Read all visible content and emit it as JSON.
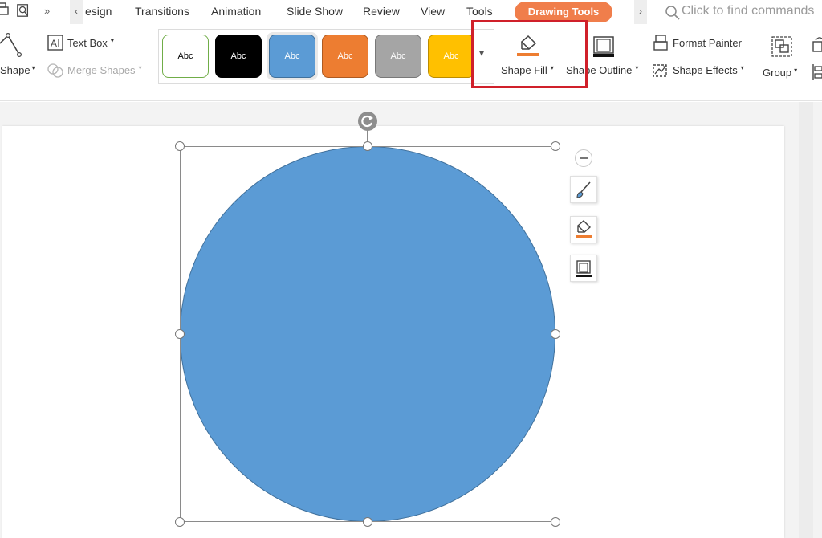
{
  "tabs": {
    "design": "esign",
    "transitions": "Transitions",
    "animation": "Animation",
    "slide_show": "Slide Show",
    "review": "Review",
    "view": "View",
    "tools": "Tools",
    "drawing_tools": "Drawing Tools"
  },
  "search": {
    "placeholder": "Click to find commands"
  },
  "ribbon": {
    "shape": "Shape",
    "text_box": "Text Box",
    "merge_shapes": "Merge Shapes",
    "shape_fill": "Shape Fill",
    "shape_outline": "Shape Outline",
    "format_painter": "Format Painter",
    "shape_effects": "Shape Effects",
    "group": "Group"
  },
  "style_gallery": [
    {
      "label": "Abc",
      "fill": "#ffffff",
      "border": "#70ad47",
      "text": "#000000"
    },
    {
      "label": "Abc",
      "fill": "#000000",
      "border": "#000000",
      "text": "#ffffff"
    },
    {
      "label": "Abc",
      "fill": "#5b9bd5",
      "border": "#41719c",
      "text": "#ffffff"
    },
    {
      "label": "Abc",
      "fill": "#ed7d31",
      "border": "#ae5a21",
      "text": "#ffffff"
    },
    {
      "label": "Abc",
      "fill": "#a5a5a5",
      "border": "#787878",
      "text": "#ffffff"
    },
    {
      "label": "Abc",
      "fill": "#ffc000",
      "border": "#bc8c00",
      "text": "#ffffff"
    }
  ],
  "colors": {
    "drawing_tools_tab": "#f07e4b",
    "highlight_box": "#d0202a",
    "shape_fill": "#5b9bd5",
    "shape_outline": "#41719c"
  }
}
